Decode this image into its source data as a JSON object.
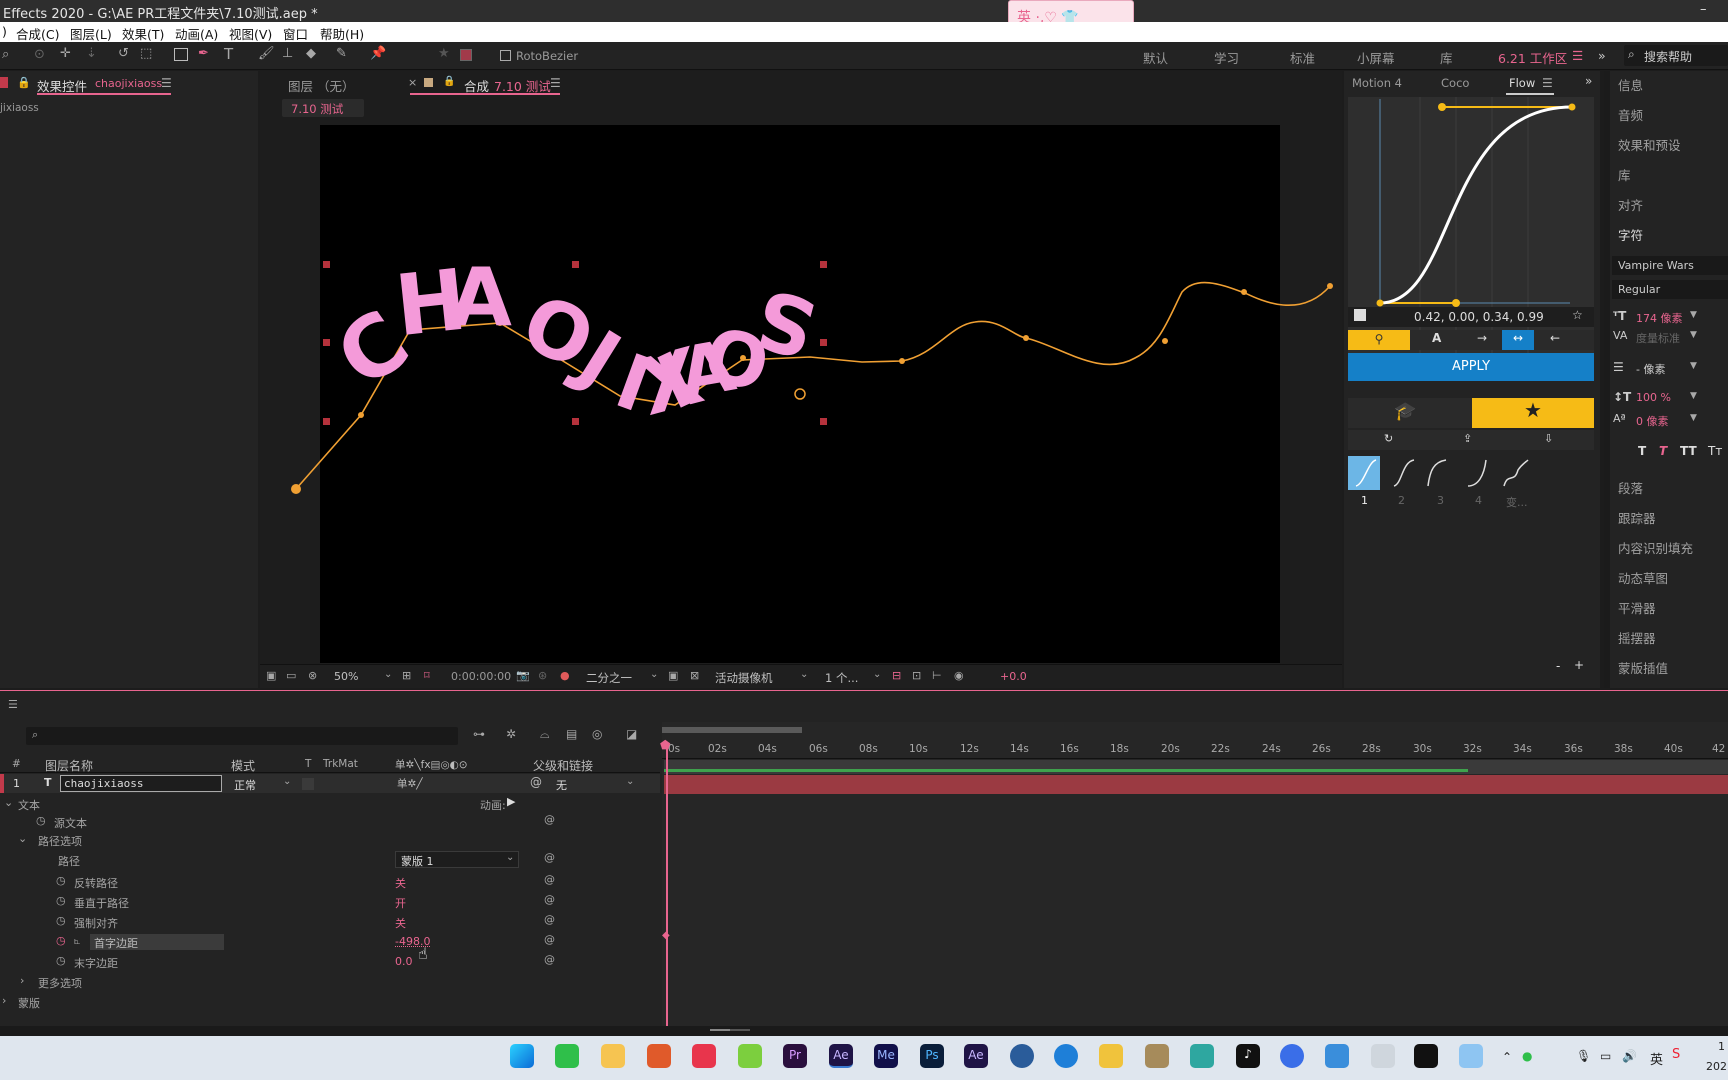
{
  "app": {
    "title": "Effects 2020 - G:\\AE PR工程文件夹\\7.10测试.aep *"
  },
  "ime": {
    "label": "英 ·,♡ 👕"
  },
  "menu": [
    "合成(C)",
    "图层(L)",
    "效果(T)",
    "动画(A)",
    "视图(V)",
    "窗口",
    "帮助(H)"
  ],
  "toolbar": {
    "rotobezier": "RotoBezier",
    "workspaces": [
      "默认",
      "学习",
      "标准",
      "小屏幕",
      "库"
    ],
    "active_workspace": "6.21 工作区",
    "search_placeholder": "搜索帮助"
  },
  "effects_panel": {
    "tab": "效果控件",
    "layer": "chaojixiaoss",
    "sub": "jixiaoss"
  },
  "comp_panel": {
    "layer_tab": "图层 （无）",
    "comp_tab_prefix": "合成",
    "comp_name": "7.10 测试",
    "crumb": "7.10 测试"
  },
  "viewer": {
    "text_glyphs": [
      "C",
      "H",
      "A",
      "O",
      "J",
      "I",
      "X",
      "I",
      "A",
      "O",
      "S",
      "S"
    ],
    "zoom": "50%",
    "timecode": "0:00:00:00",
    "resolution": "二分之一",
    "camera": "活动摄像机",
    "views": "1 个...",
    "exposure": "+0.0"
  },
  "flow": {
    "tabs": [
      "Motion 4",
      "Coco",
      "Flow"
    ],
    "values": "0.42, 0.00, 0.34, 0.99",
    "apply": "APPLY",
    "presets": [
      "1",
      "2",
      "3",
      "4",
      "变..."
    ],
    "minus": "-",
    "plus": "+"
  },
  "right_panel": {
    "items": [
      "信息",
      "音频",
      "效果和预设",
      "库",
      "对齐",
      "字符"
    ],
    "font": "Vampire Wars",
    "style": "Regular",
    "size": "174 像素",
    "kerning": "度量标准",
    "leading": "- 像素",
    "vscale": "100 %",
    "baseline": "0 像素",
    "items2": [
      "段落",
      "跟踪器",
      "内容识别填充",
      "动态草图",
      "平滑器",
      "摇摆器",
      "蒙版插值"
    ]
  },
  "timeline": {
    "search_placeholder": "",
    "cols": {
      "num": "#",
      "name": "图层名称",
      "mode": "模式",
      "t": "T",
      "trkmat": "TrkMat",
      "parent": "父级和链接"
    },
    "layer": {
      "num": "1",
      "name": "chaojixiaoss",
      "mode": "正常",
      "parent": "无"
    },
    "animate": "动画:",
    "props": [
      {
        "label": "文本",
        "indent": 0,
        "value": ""
      },
      {
        "label": "源文本",
        "indent": 2,
        "value": ""
      },
      {
        "label": "路径选项",
        "indent": 1,
        "value": ""
      },
      {
        "label": "路径",
        "indent": 3,
        "value": "蒙版 1"
      },
      {
        "label": "反转路径",
        "indent": 3,
        "value": "关"
      },
      {
        "label": "垂直于路径",
        "indent": 3,
        "value": "开"
      },
      {
        "label": "强制对齐",
        "indent": 3,
        "value": "关"
      },
      {
        "label": "首字边距",
        "indent": 3,
        "value": "-498.0"
      },
      {
        "label": "末字边距",
        "indent": 3,
        "value": "0.0"
      },
      {
        "label": "更多选项",
        "indent": 1,
        "value": ""
      },
      {
        "label": "蒙版",
        "indent": 0,
        "value": ""
      }
    ],
    "ruler": [
      "0s",
      "02s",
      "04s",
      "06s",
      "08s",
      "10s",
      "12s",
      "14s",
      "16s",
      "18s",
      "20s",
      "22s",
      "24s",
      "26s",
      "28s",
      "30s",
      "32s",
      "34s",
      "36s",
      "38s",
      "40s",
      "42"
    ]
  },
  "taskbar": {
    "ime": "英",
    "clock": "1",
    "date": "202"
  },
  "colors": {
    "accent": "#e8658f",
    "flow_yellow": "#f6bb16",
    "apply_blue": "#1580c8",
    "text_pink": "#f49ad9",
    "path_orange": "#f0a033",
    "layer_bar": "#9b3a42"
  }
}
